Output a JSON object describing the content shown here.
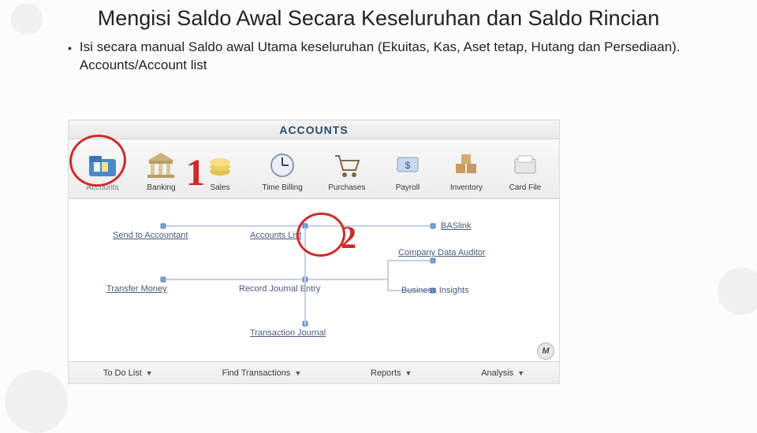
{
  "slide": {
    "title": "Mengisi Saldo Awal Secara Keseluruhan dan Saldo Rincian",
    "bullet": "Isi secara manual Saldo awal Utama keseluruhan (Ekuitas, Kas, Aset tetap, Hutang dan Persediaan). Accounts/Account list"
  },
  "app": {
    "title": "ACCOUNTS",
    "nav": [
      {
        "name": "accounts",
        "label": "Accounts"
      },
      {
        "name": "banking",
        "label": "Banking"
      },
      {
        "name": "sales",
        "label": "Sales"
      },
      {
        "name": "timebilling",
        "label": "Time Billing"
      },
      {
        "name": "purchases",
        "label": "Purchases"
      },
      {
        "name": "payroll",
        "label": "Payroll"
      },
      {
        "name": "inventory",
        "label": "Inventory"
      },
      {
        "name": "cardfile",
        "label": "Card File"
      }
    ],
    "links": {
      "send_to_accountant": "Send to Accountant",
      "accounts_list": "Accounts List",
      "baslink": "BASlink",
      "transfer_money": "Transfer Money",
      "record_journal_entry": "Record Journal Entry",
      "company_data_auditor": "Company Data Auditor",
      "business_insights": "Business Insights",
      "transaction_journal": "Transaction Journal"
    },
    "bottom": {
      "todo": "To Do List",
      "find": "Find Transactions",
      "reports": "Reports",
      "analysis": "Analysis"
    }
  },
  "callouts": {
    "one": "1",
    "two": "2"
  }
}
